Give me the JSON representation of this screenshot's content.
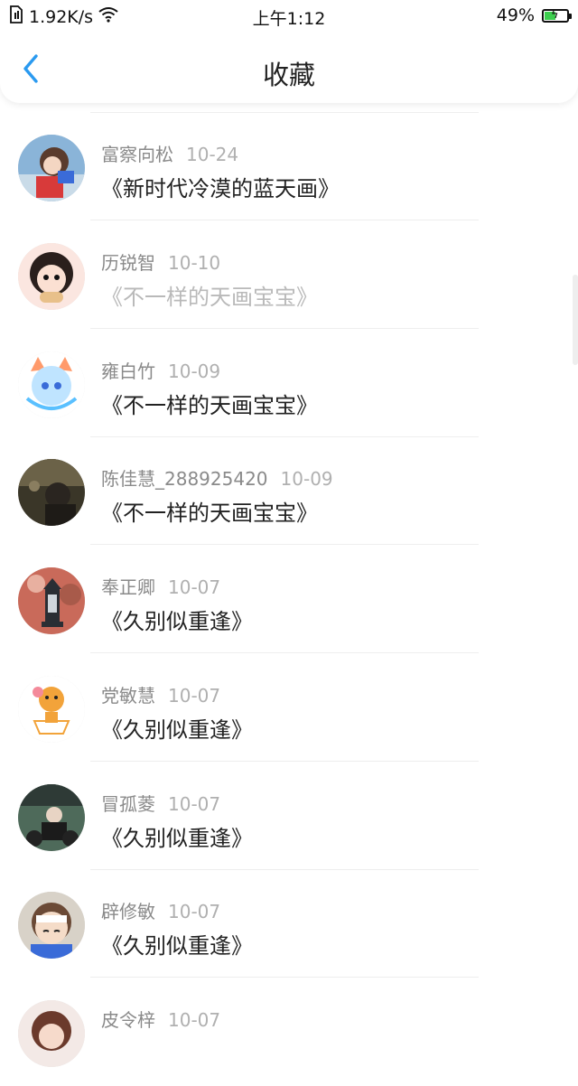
{
  "status_bar": {
    "speed": "1.92K/s",
    "time": "上午1:12",
    "battery": "49%",
    "battery_level": 0.49,
    "icons": [
      "sim-icon",
      "wifi-icon",
      "battery-charging-icon"
    ]
  },
  "header": {
    "title": "收藏",
    "back_icon": "chevron-left-icon"
  },
  "colors": {
    "accent": "#2a9af0",
    "name_text": "#8a8a8a",
    "date_text": "#b0b0b0",
    "book_text": "#222222",
    "book_text_faded": "#b9b9b9"
  },
  "items": [
    {
      "name": "富察向松",
      "date": "10-24",
      "book": "《新时代冷漠的蓝天画》",
      "avatar": "girl-with-red-scarf-avatar"
    },
    {
      "name": "历锐智",
      "date": "10-10",
      "book": "《不一样的天画宝宝》",
      "avatar": "girl-eating-noodles-avatar"
    },
    {
      "name": "雍白竹",
      "date": "10-09",
      "book": "《不一样的天画宝宝》",
      "avatar": "cat-eared-girl-avatar"
    },
    {
      "name": "陈佳慧_288925420",
      "date": "10-09",
      "book": "《不一样的天画宝宝》",
      "avatar": "child-photo-avatar"
    },
    {
      "name": "奉正卿",
      "date": "10-07",
      "book": "《久别似重逢》",
      "avatar": "lantern-avatar"
    },
    {
      "name": "党敏慧",
      "date": "10-07",
      "book": "《久别似重逢》",
      "avatar": "tiger-cartoon-avatar"
    },
    {
      "name": "冒孤菱",
      "date": "10-07",
      "book": "《久别似重逢》",
      "avatar": "motorcycle-photo-avatar"
    },
    {
      "name": "辟修敏",
      "date": "10-07",
      "book": "《久别似重逢》",
      "avatar": "anime-boy-avatar"
    },
    {
      "name": "皮令梓",
      "date": "10-07",
      "book": "",
      "avatar": "woman-portrait-avatar"
    }
  ]
}
